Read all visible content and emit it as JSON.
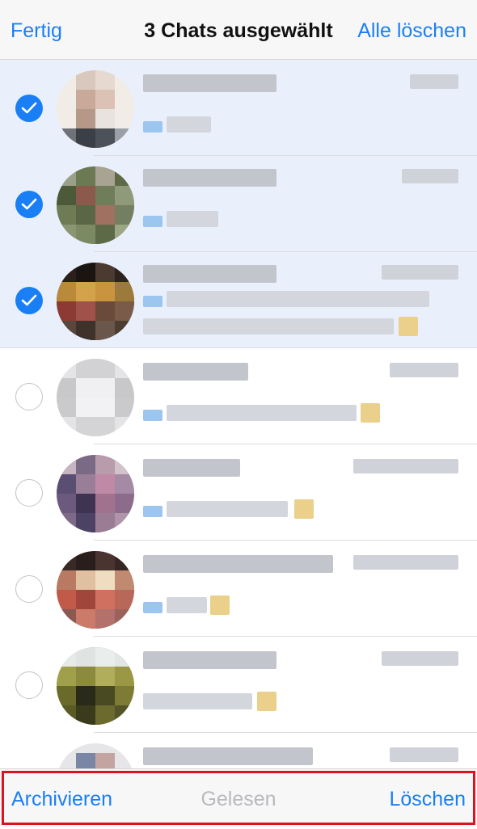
{
  "header": {
    "done_label": "Fertig",
    "title": "3 Chats ausgewählt",
    "delete_all_label": "Alle löschen"
  },
  "chats": [
    {
      "selected": true,
      "pixelated": true
    },
    {
      "selected": true,
      "pixelated": true
    },
    {
      "selected": true,
      "pixelated": true
    },
    {
      "selected": false,
      "pixelated": true
    },
    {
      "selected": false,
      "pixelated": true
    },
    {
      "selected": false,
      "pixelated": true
    },
    {
      "selected": false,
      "pixelated": true
    },
    {
      "selected": false,
      "pixelated": true
    }
  ],
  "toolbar": {
    "archive_label": "Archivieren",
    "read_label": "Gelesen",
    "delete_label": "Löschen"
  },
  "colors": {
    "accent": "#1a7ff5",
    "selected_row": "#e9f0fb",
    "disabled_text": "#b9b9be",
    "highlight_frame": "#d9131f"
  },
  "icons": {
    "selected_indicator": "checkmark-circle-icon",
    "unselected_indicator": "empty-circle-icon"
  }
}
